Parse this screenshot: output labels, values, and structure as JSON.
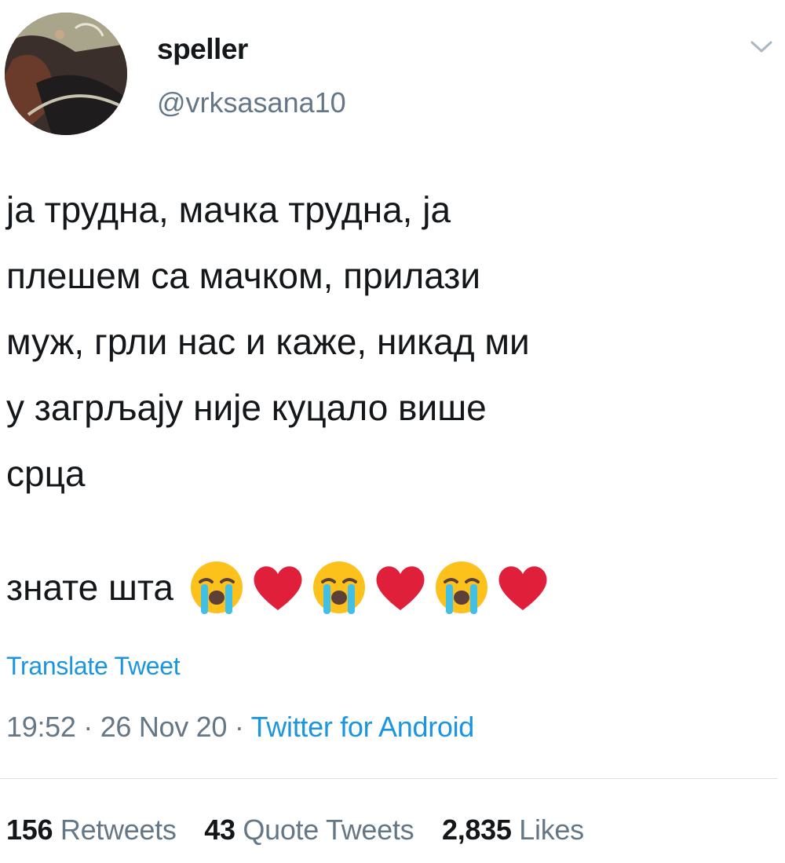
{
  "user": {
    "display_name": "speller",
    "handle": "@vrksasana10",
    "avatar_icon": "profile-photo"
  },
  "tweet": {
    "text": "ја трудна, мачка трудна, ја\nплешем са мачком, прилази\nмуж, грли нас и каже, никад ми\nу загрљају није куцало више\nсрца",
    "line2_text": "знате шта",
    "emojis": [
      "loudly-crying-face",
      "red-heart",
      "loudly-crying-face",
      "red-heart",
      "loudly-crying-face",
      "red-heart"
    ],
    "translate_label": "Translate Tweet",
    "time": "19:52",
    "date": "26 Nov 20",
    "separator": "·",
    "source": "Twitter for Android"
  },
  "stats": {
    "retweets_count": "156",
    "retweets_label": "Retweets",
    "quote_count": "43",
    "quote_label": "Quote Tweets",
    "likes_count": "2,835",
    "likes_label": "Likes"
  },
  "colors": {
    "link": "#1b95e0",
    "secondary": "#657786",
    "primary": "#14171a",
    "divider": "#dcdfe2",
    "heart": "#e0203a"
  }
}
